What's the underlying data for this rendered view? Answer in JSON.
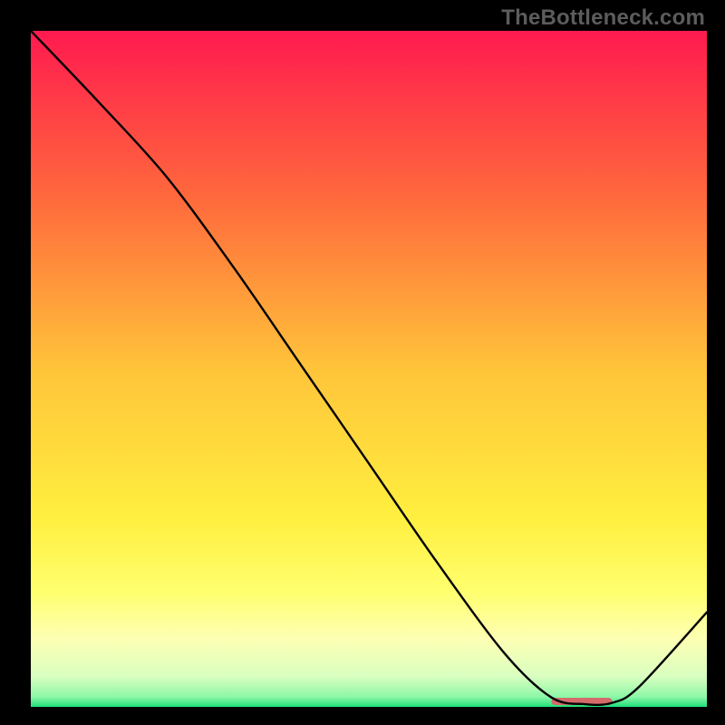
{
  "watermark": "TheBottleneck.com",
  "chart_data": {
    "type": "line",
    "title": "",
    "xlabel": "",
    "ylabel": "",
    "xlim": [
      0,
      100
    ],
    "ylim": [
      0,
      100
    ],
    "grid": false,
    "series": [
      {
        "name": "curve",
        "x": [
          0,
          10,
          20,
          30,
          40,
          50,
          60,
          70,
          77,
          82,
          86,
          90,
          100
        ],
        "y": [
          100,
          89.5,
          78.5,
          65,
          50.5,
          36,
          21.5,
          8,
          1.4,
          0.4,
          0.6,
          3,
          14
        ],
        "color": "#000000"
      }
    ],
    "marker": {
      "present": true,
      "x_start": 77,
      "x_end": 86,
      "y": 0.8,
      "color": "#d66a6a"
    },
    "background_gradient": {
      "type": "vertical",
      "stops": [
        {
          "pos": 0.0,
          "color": "#ff1a4f"
        },
        {
          "pos": 0.25,
          "color": "#ff6a3c"
        },
        {
          "pos": 0.5,
          "color": "#ffc43a"
        },
        {
          "pos": 0.72,
          "color": "#ffef3f"
        },
        {
          "pos": 0.83,
          "color": "#ffff6e"
        },
        {
          "pos": 0.9,
          "color": "#fdffb4"
        },
        {
          "pos": 0.955,
          "color": "#d9ffc0"
        },
        {
          "pos": 0.985,
          "color": "#8ef7a8"
        },
        {
          "pos": 1.0,
          "color": "#1ee07a"
        }
      ]
    }
  }
}
